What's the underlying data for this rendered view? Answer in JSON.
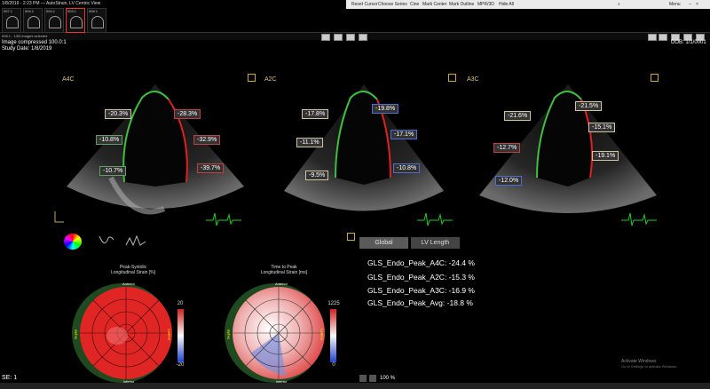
{
  "window": {
    "title": "1/8/2019 - 2:23 PM — AutoStrain, LV Centric View",
    "series_thumbs": [
      "007.1",
      "004.1",
      "004.1",
      "003.1",
      "006.1"
    ],
    "toolbar_items": [
      "Reset Cursor",
      "Choose Series",
      "Cine",
      "Mark Center",
      "Mark Outline",
      "MPR/3D",
      "Hide All"
    ],
    "menu_label": "Menu",
    "status_line": "008.1 - 1/83 images selected"
  },
  "header": {
    "compression": "Image compressed 100.0:1",
    "study_date": "Study Date: 1/8/2019",
    "dob": "DOB: 1/1/0001"
  },
  "views": [
    {
      "label": "A4C",
      "segments": [
        "-20.3%",
        "-28.3%",
        "-10.8%",
        "-32.9%",
        "-10.7%",
        "-39.7%"
      ]
    },
    {
      "label": "A2C",
      "segments": [
        "-17.8%",
        "-19.8%",
        "-11.1%",
        "-17.1%",
        "-9.5%",
        "-10.8%"
      ]
    },
    {
      "label": "A3C",
      "segments": [
        "-21.6%",
        "-21.5%",
        "-15.1%",
        "-12.7%",
        "-19.1%",
        "-12.0%"
      ]
    }
  ],
  "tabs": {
    "global": "Global",
    "lv_length": "LV Length"
  },
  "gls": [
    "GLS_Endo_Peak_A4C: -24.4 %",
    "GLS_Endo_Peak_A2C: -15.3 %",
    "GLS_Endo_Peak_A3C: -16.9 %",
    "GLS_Endo_Peak_Avg: -18.8 %"
  ],
  "bullseye_strain": {
    "title": "Peak-Systolic\nLongitudinal Strain [%]",
    "anterior": "Anterior",
    "inferior": "Inferior",
    "septal": "Septal",
    "lateral": "Lateral",
    "scale_max": "20",
    "scale_min": "-20"
  },
  "bullseye_time": {
    "title": "Time to Peak\nLongitudinal Strain [ms]",
    "anterior": "Anterior",
    "inferior": "Inferior",
    "septal": "Septal",
    "lateral": "Lateral",
    "scale_max": "1225",
    "scale_min": "0"
  },
  "footer": {
    "series": "SE: 1",
    "zoom": "100 %",
    "activate": "Activate Windows",
    "activate_sub": "Go to Settings to activate Windows."
  },
  "colors": {
    "label": "#d6c67a",
    "accent_green": "#3fbf3f",
    "strain_red": "#e02020",
    "ecg": "#22cc22"
  }
}
